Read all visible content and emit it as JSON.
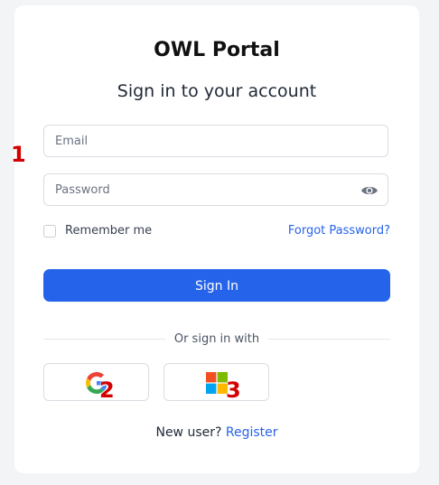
{
  "app": {
    "title": "OWL Portal",
    "subtitle": "Sign in to your account"
  },
  "form": {
    "email_placeholder": "Email",
    "email_value": "",
    "password_placeholder": "Password",
    "password_value": "",
    "remember_label": "Remember me",
    "remember_checked": false,
    "forgot_label": "Forgot Password?",
    "signin_label": "Sign In"
  },
  "social": {
    "divider_text": "Or sign in with",
    "providers": [
      {
        "name": "google",
        "icon": "google-icon"
      },
      {
        "name": "microsoft",
        "icon": "microsoft-icon"
      }
    ]
  },
  "register": {
    "prompt": "New user?",
    "link_label": "Register"
  },
  "annotations": [
    "1",
    "2",
    "3"
  ],
  "colors": {
    "accent": "#2563eb",
    "annotation": "#d40000",
    "background": "#f3f4f6"
  }
}
